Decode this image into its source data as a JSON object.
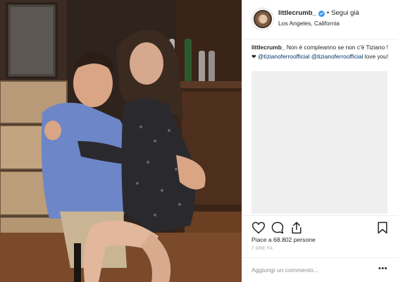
{
  "post": {
    "username": "littlecrumb_",
    "separator": "•",
    "follow_label": "Segui già",
    "location": "Los Angeles, California",
    "caption": {
      "username": "littlecrumb_",
      "text_1": "Non è compleanno se non c'è Tiziano !",
      "heart": "❤",
      "mention_1": "@tizianoferroofficial",
      "mention_2": "@tizianoferroofficial",
      "text_2": "love you!"
    },
    "likes": "Piace a 68.802 persone",
    "time_ago": "7 ORE FA",
    "comment_placeholder": "Aggiungi un commento...",
    "more_label": "•••"
  },
  "icons": {
    "verified": "verified-badge-icon",
    "like": "heart-icon",
    "comment": "comment-icon",
    "share": "share-icon",
    "save": "bookmark-icon",
    "more": "more-options-icon"
  },
  "colors": {
    "verified": "#3897f0",
    "mention": "#003569",
    "muted": "#8e8e8e",
    "border": "#efefef",
    "placeholder_bg": "#efefef"
  }
}
